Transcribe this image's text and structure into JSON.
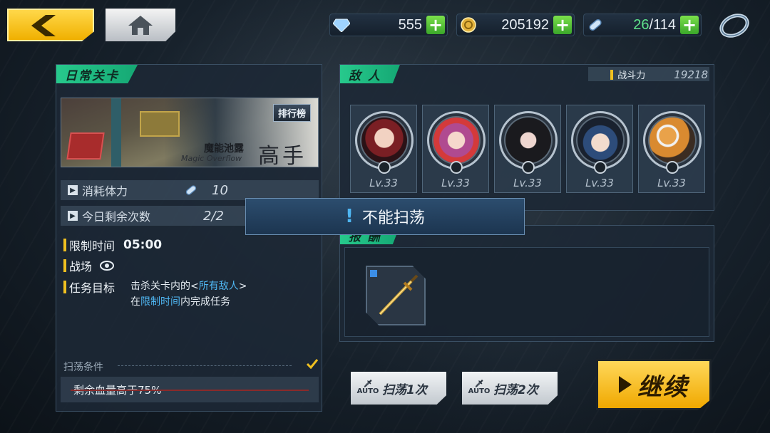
{
  "resources": {
    "gems": "555",
    "coins": "205192",
    "stamina_current": "26",
    "stamina_sep_max": "/114"
  },
  "stage": {
    "section_label": "日常关卡",
    "leaderboard_label": "排行榜",
    "name_cn": "魔能池露",
    "name_en": "Magic Overflow",
    "difficulty": "高手",
    "stamina_cost_label": "消耗体力",
    "stamina_cost_value": "10",
    "remaining_label": "今日剩余次数",
    "remaining_value": "2/2",
    "time_limit_label": "限制时间",
    "time_limit_value": "05:00",
    "battlefield_label": "战场",
    "objective_label": "任务目标",
    "objective_line1_a": "击杀关卡内的<",
    "objective_line1_hl": "所有敌人",
    "objective_line1_b": ">",
    "objective_line2_a": "在",
    "objective_line2_hl": "限制时间",
    "objective_line2_b": "内完成任务",
    "sweep_conditions_label": "扫荡条件",
    "sweep_condition": "剩余血量高于75%"
  },
  "enemies": {
    "section_label": "敌 人",
    "power_label": "战斗力",
    "power_value": "19218",
    "list": [
      {
        "level": "Lv.33"
      },
      {
        "level": "Lv.33"
      },
      {
        "level": "Lv.33"
      },
      {
        "level": "Lv.33"
      },
      {
        "level": "Lv.33"
      }
    ]
  },
  "rewards": {
    "section_label": "报 酬",
    "items": [
      {
        "icon": "golden-sword-icon"
      }
    ]
  },
  "toast": {
    "message": "不能扫荡"
  },
  "actions": {
    "auto_label": "AUTO",
    "sweep_once": "扫荡1次",
    "sweep_twice": "扫荡2次",
    "continue": "继续"
  },
  "colors": {
    "accent_green": "#1fbf84",
    "accent_yellow": "#f0b000",
    "highlight_blue": "#4fb6f2"
  }
}
